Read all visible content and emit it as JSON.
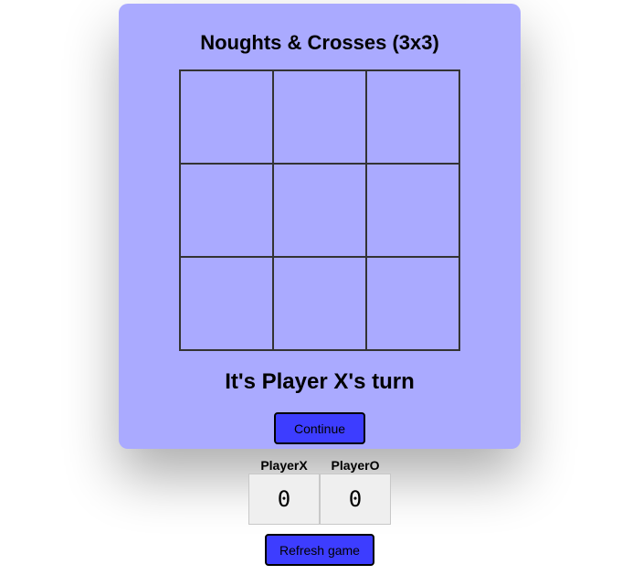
{
  "game": {
    "title": "Noughts & Crosses (3x3)",
    "board": [
      "",
      "",
      "",
      "",
      "",
      "",
      "",
      "",
      ""
    ],
    "status": "It's Player X's turn",
    "continue_label": "Continue"
  },
  "scoreboard": {
    "players": [
      {
        "label": "PlayerX",
        "score": "0"
      },
      {
        "label": "PlayerO",
        "score": "0"
      }
    ]
  },
  "refresh_label": "Refresh game",
  "colors": {
    "card_background": "#aaaaff",
    "button_background": "#3d3dff",
    "grid_line": "#333333"
  }
}
